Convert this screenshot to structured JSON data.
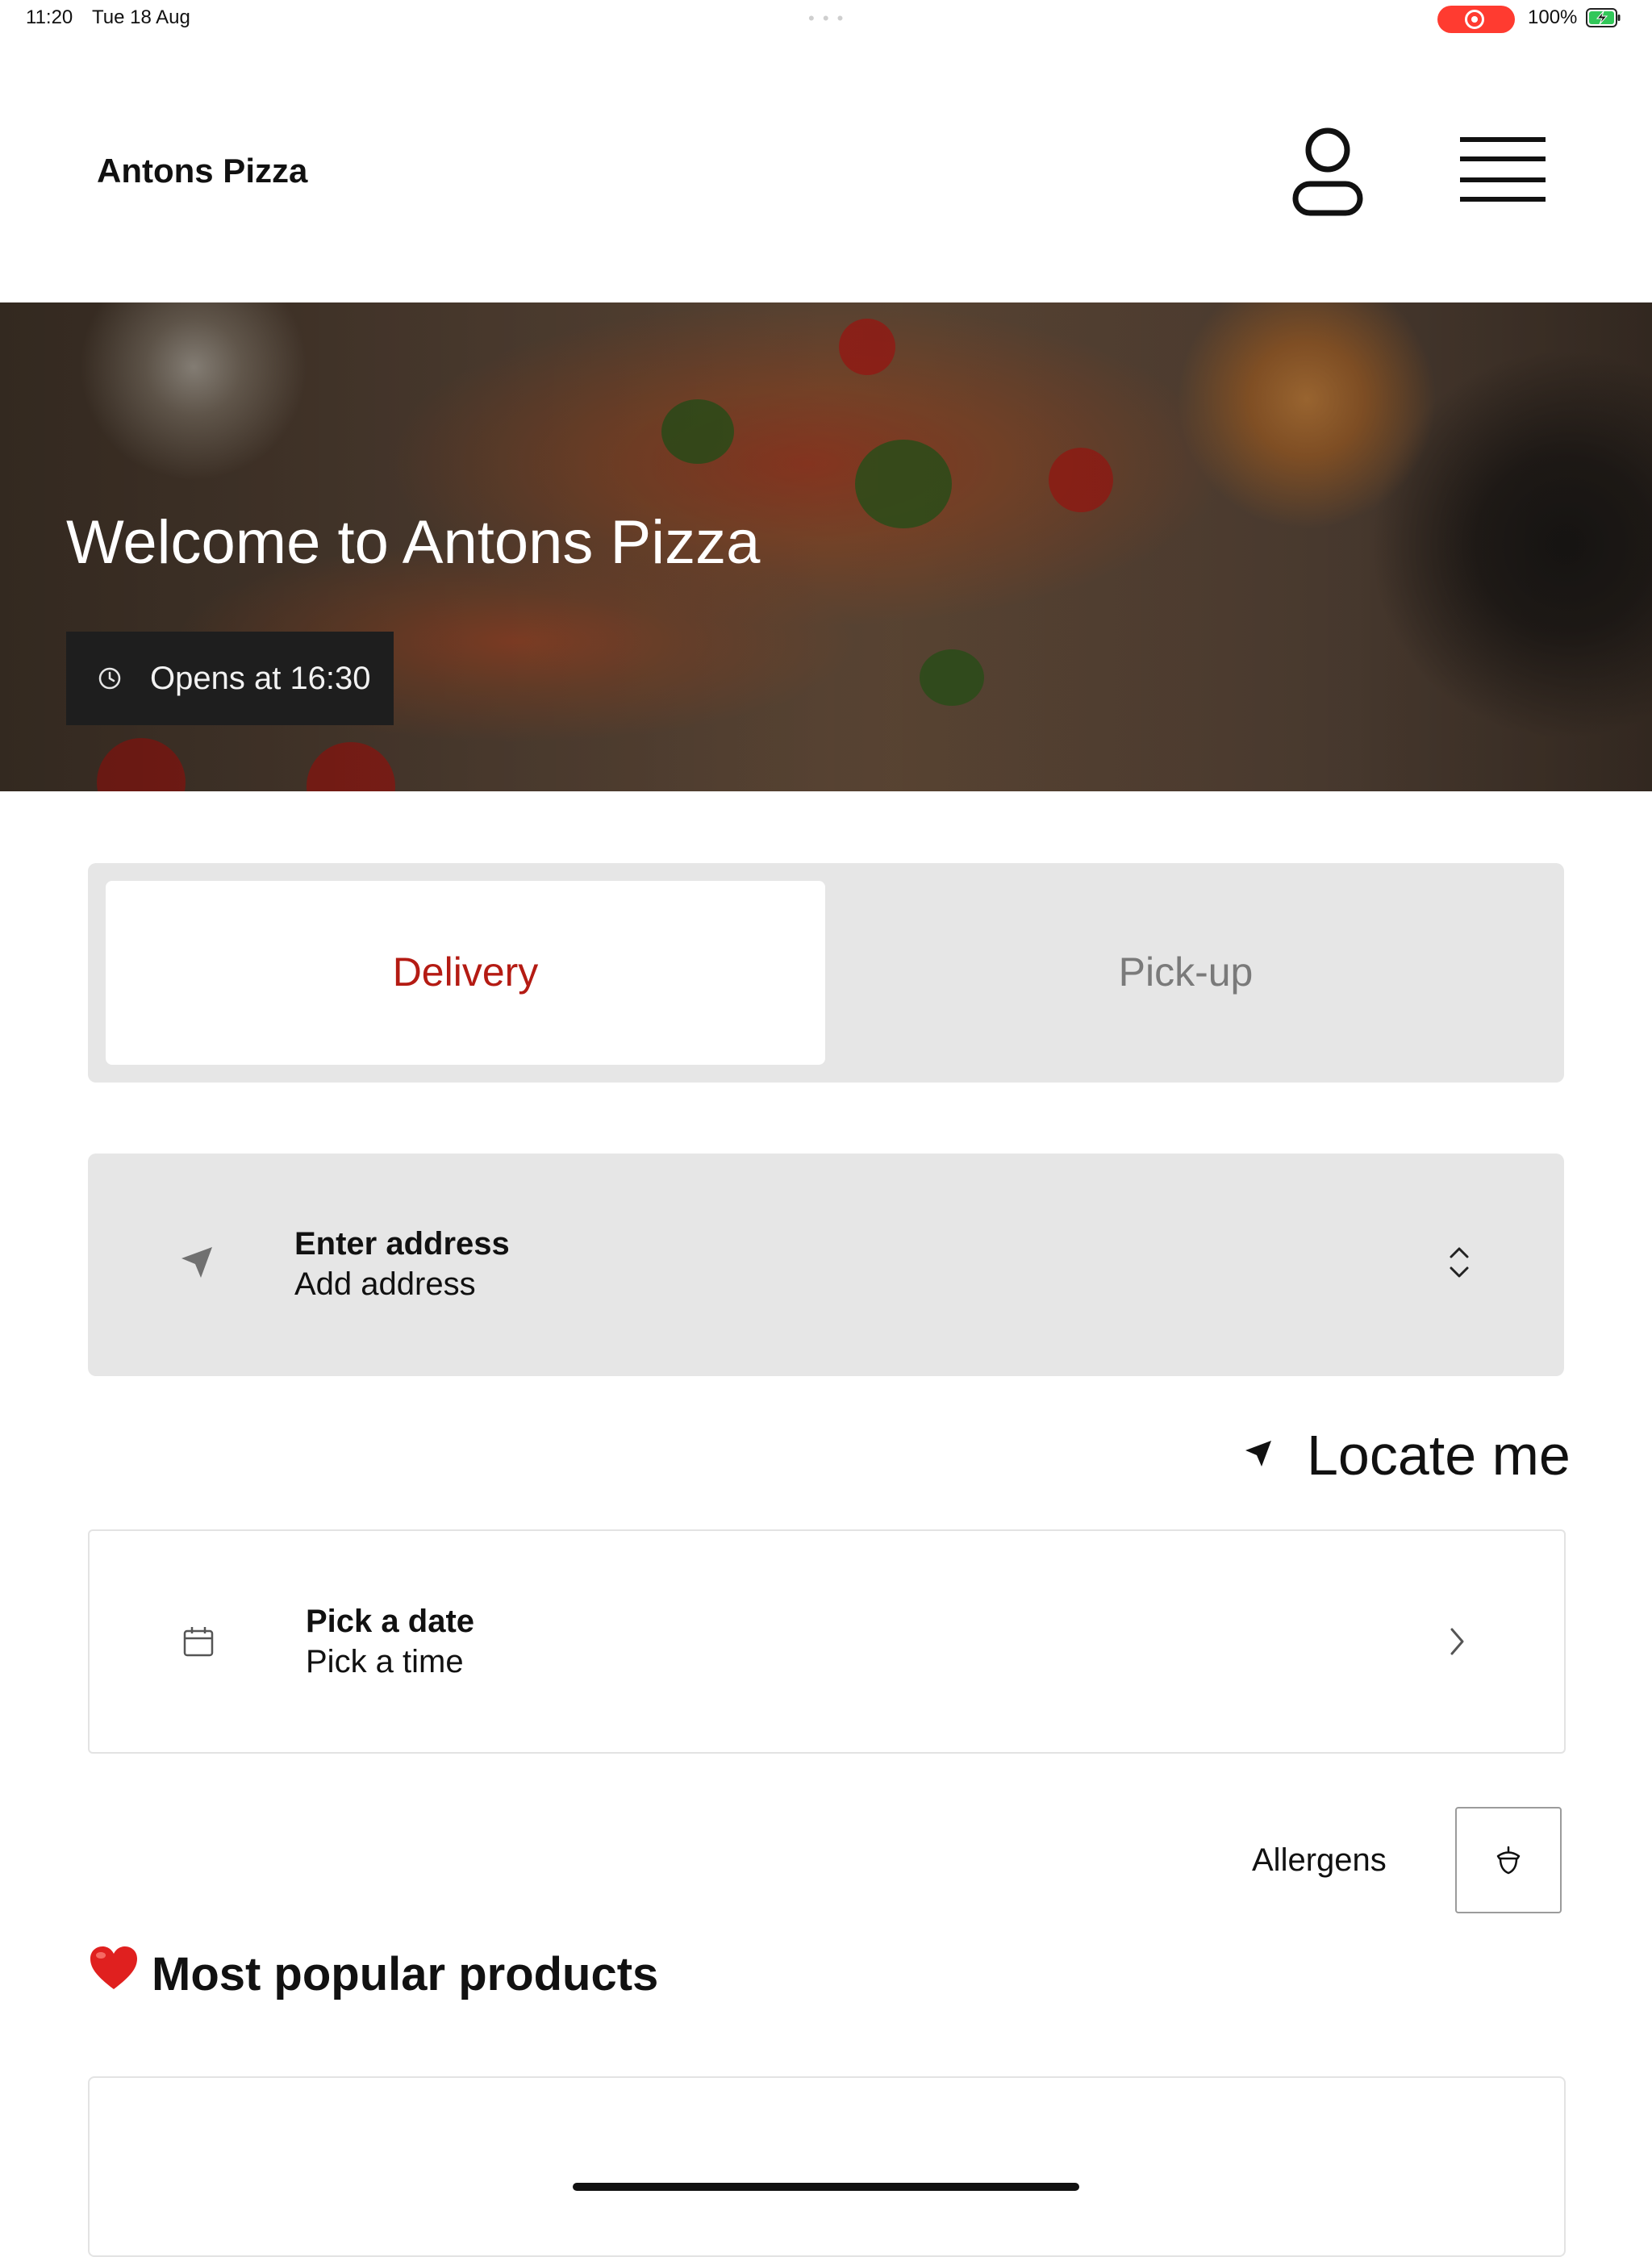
{
  "status_bar": {
    "time": "11:20",
    "date": "Tue 18 Aug",
    "battery": "100%",
    "icons": [
      "screen-record-icon",
      "battery-charging-icon"
    ],
    "record_color": "#ff3b30",
    "battery_color": "#32c759"
  },
  "header": {
    "brand": "Antons Pizza",
    "icons": [
      "profile-icon",
      "hamburger-menu-icon"
    ]
  },
  "hero": {
    "title": "Welcome to Antons Pizza",
    "opening": "Opens at 16:30",
    "icons": [
      "clock-icon"
    ]
  },
  "order_mode": {
    "tabs": [
      {
        "label": "Delivery",
        "selected": true
      },
      {
        "label": "Pick-up",
        "selected": false
      }
    ],
    "accent_color": "#b41b13"
  },
  "address": {
    "title": "Enter address",
    "subtitle": "Add address",
    "icons": [
      "location-arrow-icon",
      "up-down-chevron-icon"
    ]
  },
  "locate": {
    "label": "Locate me",
    "icon": "location-arrow-icon"
  },
  "schedule": {
    "title": "Pick a date",
    "subtitle": "Pick a time",
    "icons": [
      "calendar-icon",
      "chevron-right-icon"
    ]
  },
  "allergens": {
    "label": "Allergens",
    "icon": "acorn-icon"
  },
  "popular": {
    "title": "Most popular products",
    "icon": "heart-icon"
  }
}
